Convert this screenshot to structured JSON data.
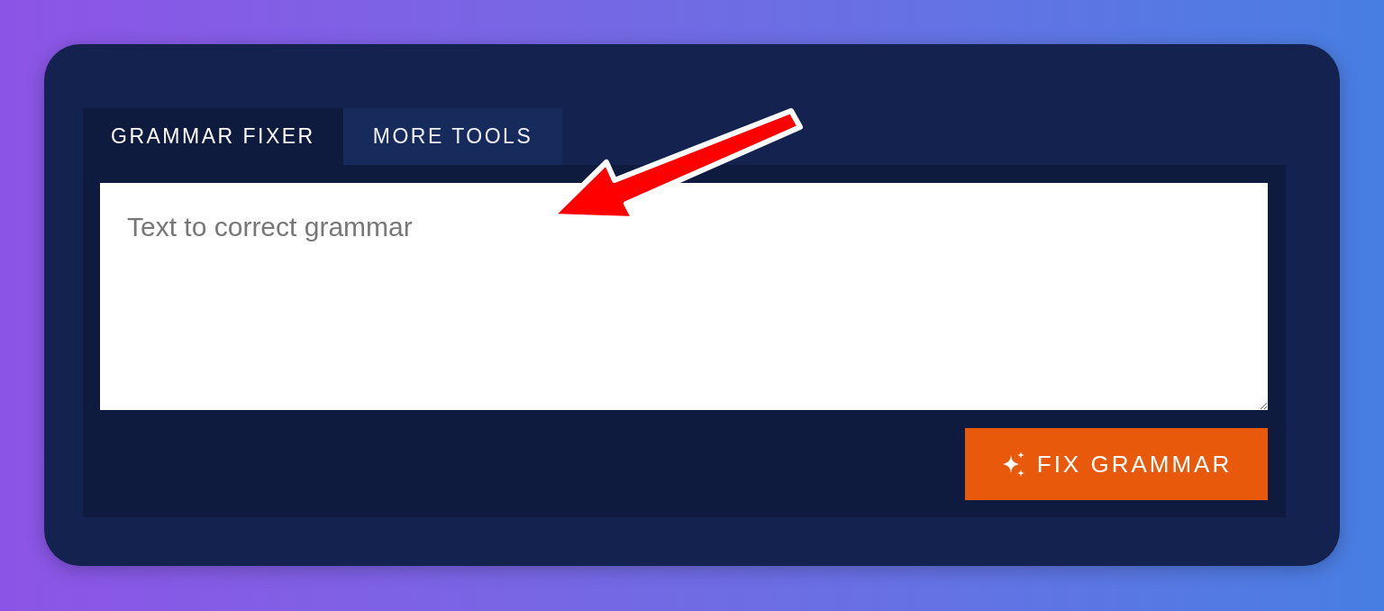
{
  "tabs": [
    {
      "label": "GRAMMAR FIXER",
      "selected": true
    },
    {
      "label": "MORE TOOLS",
      "selected": false
    }
  ],
  "text_input": {
    "placeholder": "Text to correct grammar"
  },
  "button": {
    "label": "FIX GRAMMAR"
  }
}
